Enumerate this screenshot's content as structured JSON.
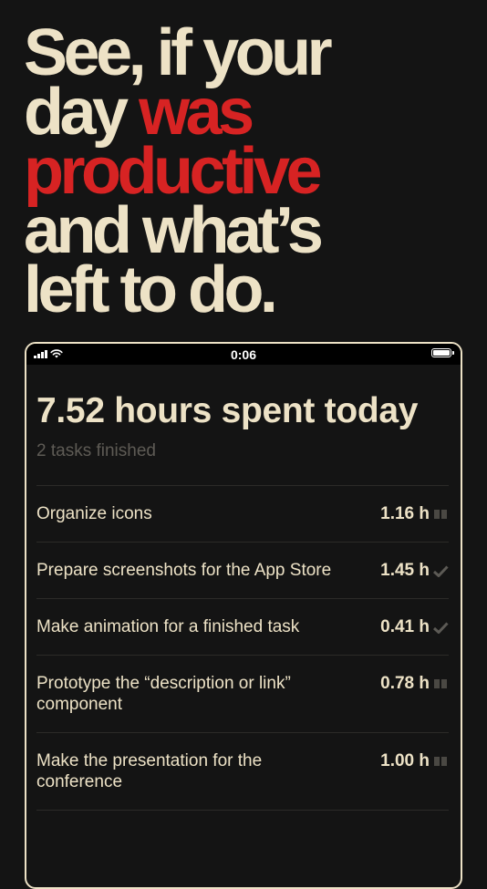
{
  "headline": {
    "line1": "See, if your",
    "line2_a": "day ",
    "line2_b": "was",
    "line3": "productive",
    "line4": "and what’s",
    "line5": "left to do."
  },
  "colors": {
    "background": "#141414",
    "cream": "#EDE2C6",
    "accent_red": "#D72323",
    "muted": "#5E5B55"
  },
  "status_bar": {
    "time": "0:06"
  },
  "summary": {
    "title": "7.52 hours spent today",
    "subtitle": "2 tasks finished"
  },
  "tasks": [
    {
      "name": "Organize icons",
      "hours": "1.16 h",
      "status_icon": "pause-icon"
    },
    {
      "name": "Prepare screenshots for the App Store",
      "hours": "1.45 h",
      "status_icon": "check-icon"
    },
    {
      "name": "Make animation for a finished task",
      "hours": "0.41 h",
      "status_icon": "check-icon"
    },
    {
      "name": "Prototype the “description or link” component",
      "hours": "0.78 h",
      "status_icon": "pause-icon"
    },
    {
      "name": "Make the presentation for the conference",
      "hours": "1.00 h",
      "status_icon": "pause-icon"
    }
  ]
}
